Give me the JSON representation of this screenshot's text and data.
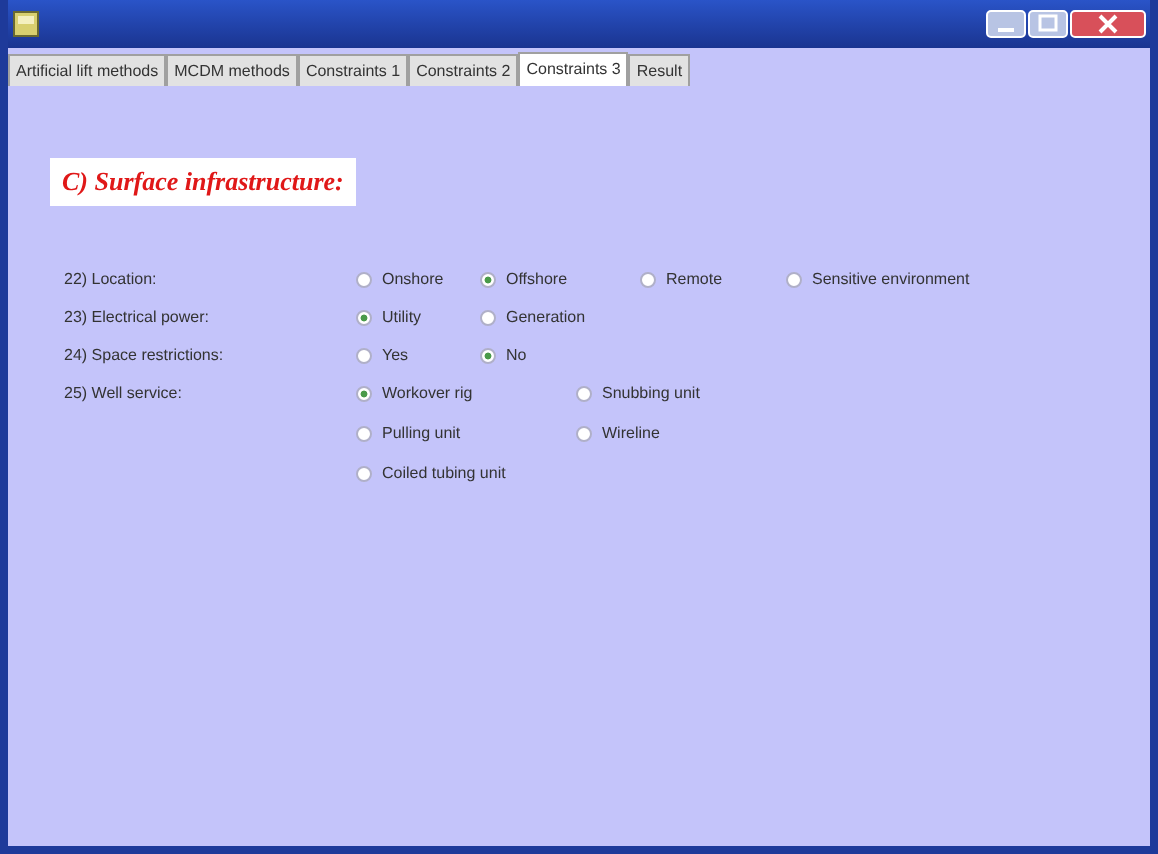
{
  "tabs": [
    {
      "label": "Artificial lift methods",
      "selected": false
    },
    {
      "label": "MCDM methods",
      "selected": false
    },
    {
      "label": "Constraints 1",
      "selected": false
    },
    {
      "label": "Constraints 2",
      "selected": false
    },
    {
      "label": "Constraints 3",
      "selected": true
    },
    {
      "label": "Result",
      "selected": false
    }
  ],
  "heading": "C) Surface infrastructure:",
  "questions": [
    {
      "label": "22) Location:",
      "options": [
        {
          "label": "Onshore",
          "selected": false
        },
        {
          "label": "Offshore",
          "selected": true
        },
        {
          "label": "Remote",
          "selected": false
        },
        {
          "label": "Sensitive environment",
          "selected": false
        }
      ]
    },
    {
      "label": "23) Electrical power:",
      "options": [
        {
          "label": "Utility",
          "selected": true
        },
        {
          "label": "Generation",
          "selected": false
        }
      ]
    },
    {
      "label": "24) Space restrictions:",
      "options": [
        {
          "label": "Yes",
          "selected": false
        },
        {
          "label": "No",
          "selected": true
        }
      ]
    },
    {
      "label": "25) Well service:",
      "options": [
        {
          "label": "Workover rig",
          "selected": true
        },
        {
          "label": "Snubbing unit",
          "selected": false
        },
        {
          "label": "Pulling unit",
          "selected": false
        },
        {
          "label": "Wireline",
          "selected": false
        },
        {
          "label": "Coiled tubing unit",
          "selected": false
        }
      ]
    }
  ]
}
